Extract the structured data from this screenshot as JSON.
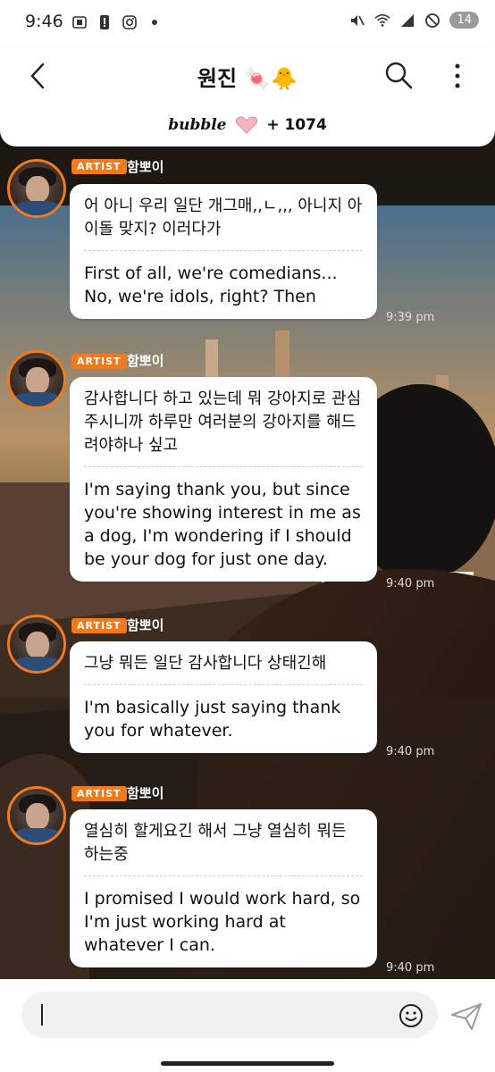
{
  "status_bar": {
    "time": "9:46",
    "battery_percent": "14",
    "left_icons": [
      "screenshot-icon",
      "alert-icon",
      "instagram-icon",
      "dot-icon"
    ],
    "right_icons": [
      "mute-icon",
      "wifi-icon",
      "signal-icon",
      "do-not-disturb-icon"
    ]
  },
  "header": {
    "title": "원진 🍬🐥",
    "service_name": "bubble",
    "subscriber_count": "+ 1074"
  },
  "messages": [
    {
      "badge": "ARTIST",
      "sender": "함뽀이",
      "korean": "어 아니 우리 일단 개그매,,ㄴ,,, 아니지 아이돌 맞지? 이러다가",
      "english": "First of all, we're comedians... No, we're idols, right? Then",
      "time": "9:39 pm"
    },
    {
      "badge": "ARTIST",
      "sender": "함뽀이",
      "korean": "감사합니다 하고 있는데 뭐 강아지로 관심 주시니까 하루만 여러분의 강아지를 해드려야하나 싶고",
      "english": "I'm saying thank you, but since you're showing interest in me as a dog, I'm wondering if I should be your dog for just one day.",
      "time": "9:40 pm"
    },
    {
      "badge": "ARTIST",
      "sender": "함뽀이",
      "korean": "그냥 뭐든 일단 감사합니다 상태긴해",
      "english": "I'm basically just saying thank you for whatever.",
      "time": "9:40 pm"
    },
    {
      "badge": "ARTIST",
      "sender": "함뽀이",
      "korean": "열심히 할게요긴 해서 그냥 열심히 뭐든 하는중",
      "english": "I promised I would work hard, so I'm just working hard at whatever I can.",
      "time": "9:40 pm"
    }
  ],
  "composer": {
    "emoji_icon": "smiley-icon",
    "send_icon": "send-icon"
  },
  "colors": {
    "artist_badge": "#f07a1e",
    "bubble_bg": "#ffffff"
  }
}
